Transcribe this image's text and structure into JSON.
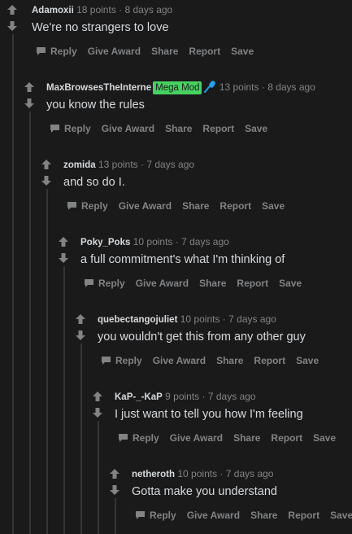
{
  "colors": {
    "background": "#1a1a1b",
    "thread_line": "#343536",
    "text": "#d7dadc",
    "muted": "#818384",
    "flair_bg": "#46d160",
    "mic_blue": "#24a0ed"
  },
  "actions": {
    "reply": "Reply",
    "give_award": "Give Award",
    "share": "Share",
    "report": "Report",
    "save": "Save"
  },
  "comments": [
    {
      "author": "Adamoxii",
      "points": "18 points",
      "sep": "·",
      "age": "8 days ago",
      "text": "We're no strangers to love"
    },
    {
      "author": "MaxBrowsesTheInterne",
      "flair": "Mega Mod",
      "flair_icon": "microphone-icon",
      "points": "13 points",
      "sep": "·",
      "age": "8 days ago",
      "text": "you know the rules"
    },
    {
      "author": "zomida",
      "points": "13 points",
      "sep": "·",
      "age": "7 days ago",
      "text": "and so do I."
    },
    {
      "author": "Poky_Poks",
      "points": "10 points",
      "sep": "·",
      "age": "7 days ago",
      "text": "a full commitment's what I'm thinking of"
    },
    {
      "author": "quebectangojuliet",
      "points": "10 points",
      "sep": "·",
      "age": "7 days ago",
      "text": "you wouldn't get this from any other guy"
    },
    {
      "author": "KaP-_-KaP",
      "points": "9 points",
      "sep": "·",
      "age": "7 days ago",
      "text": "I just want to tell you how I'm feeling"
    },
    {
      "author": "netheroth",
      "points": "10 points",
      "sep": "·",
      "age": "7 days ago",
      "text": "Gotta make you understand"
    }
  ]
}
